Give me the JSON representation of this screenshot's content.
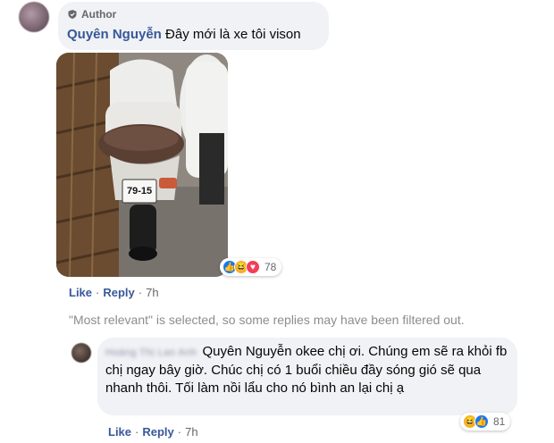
{
  "post": {
    "author_badge": "Author",
    "author_name": "Quyên Nguyễn",
    "comment_text": "Đây mới là xe tôi vison",
    "plate": "79-15",
    "reactions_count": "78",
    "actions": {
      "like": "Like",
      "reply": "Reply",
      "sep": "·",
      "time": "7h"
    }
  },
  "filter_note": "\"Most relevant\" is selected, so some replies may have been filtered out.",
  "reply": {
    "author_name_blurred": "Hoàng Thị Lan Anh",
    "mention": "Quyên Nguyễn",
    "text": " okee chị ơi. Chúng em sẽ ra khỏi fb chị ngay bây giờ. Chúc chị có 1 buổi chiều đầy sóng gió sẽ qua nhanh thôi. Tối làm nồi lẩu cho nó bình an lại chị ạ",
    "reactions_count": "81",
    "actions": {
      "like": "Like",
      "reply": "Reply",
      "sep": "·",
      "time": "7h"
    }
  },
  "colors": {
    "link": "#385898",
    "meta": "#65676b",
    "bubble": "#f0f2f5",
    "like": "#1877f2",
    "haha": "#f7b125",
    "love": "#f33e58"
  },
  "icons": [
    "author-shield-icon",
    "like-reaction-icon",
    "haha-reaction-icon",
    "love-reaction-icon"
  ]
}
